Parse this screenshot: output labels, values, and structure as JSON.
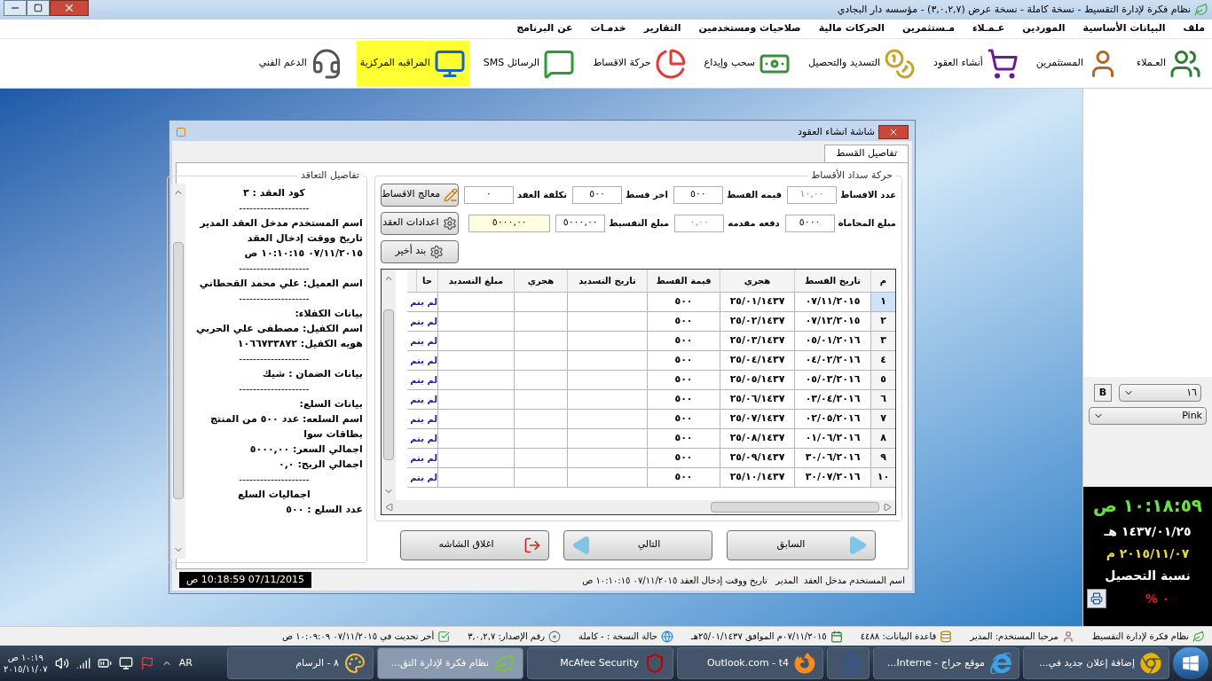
{
  "window": {
    "title": "نظام فكرة لإدارة التقسيط - نسخة كاملة - نسخة عرض (٣,٠,٢,٧) - مؤسسه دار البجادي"
  },
  "menu": [
    "ملف",
    "البيانات الأساسية",
    "الموردين",
    "عـمـلاء",
    "مـستثمرين",
    "الحركات مالية",
    "صلاحيات ومستخدمين",
    "التقارير",
    "خدمـات",
    "عن البرنامج"
  ],
  "toolbar": [
    {
      "label": "العـملاء",
      "kind": "people",
      "highlighted": false
    },
    {
      "label": "المستثمرين",
      "kind": "person",
      "highlighted": false
    },
    {
      "label": "أنشاء العقود",
      "kind": "cart",
      "highlighted": false
    },
    {
      "label": "التسديد والتحصيل",
      "kind": "coins",
      "highlighted": false
    },
    {
      "label": "سحب وإيداع",
      "kind": "cash",
      "highlighted": false
    },
    {
      "label": "حركة الاقساط",
      "kind": "pie",
      "highlighted": false
    },
    {
      "label": "الرسائل SMS",
      "kind": "sms",
      "highlighted": false
    },
    {
      "label": "المراقبه المركزية",
      "kind": "monitor",
      "highlighted": true
    },
    {
      "label": "الدعم الفني",
      "kind": "support",
      "highlighted": false
    }
  ],
  "dialog": {
    "title": "شاشة انشاء العقود",
    "tabs": [
      {
        "label": "تفاصيل القسط",
        "selected": true
      }
    ],
    "contract_details": {
      "title": "تفاصيل التعاقد",
      "lines": [
        {
          "kind": "heading",
          "text": "كود العقد : ٣"
        },
        {
          "kind": "separator",
          "text": "--------------------"
        },
        {
          "kind": "line",
          "text": "اسم المستخدم مدخل العقد المدير"
        },
        {
          "kind": "line",
          "text": "تاريخ ووقت إدخال العقد"
        },
        {
          "kind": "line",
          "text": "٠٧/١١/٢٠١٥ ١٠:١٠:١٥ ص"
        },
        {
          "kind": "separator",
          "text": "--------------------"
        },
        {
          "kind": "line",
          "text": "اسم العميل: علي محمد القحطاني"
        },
        {
          "kind": "separator",
          "text": "--------------------"
        },
        {
          "kind": "line",
          "text": "بيانات الكفلاء:"
        },
        {
          "kind": "line",
          "text": "اسم الكفيل: مصطفى علي الحربي"
        },
        {
          "kind": "line",
          "text": "هويه الكفيل: ١٠٦٦٧٣٣٨٧٢"
        },
        {
          "kind": "separator",
          "text": "--------------------"
        },
        {
          "kind": "line",
          "text": "بيانات الضمان : شيك"
        },
        {
          "kind": "separator",
          "text": "--------------------"
        },
        {
          "kind": "line",
          "text": "بيانات السلع:"
        },
        {
          "kind": "line",
          "text": "اسم السلعه: عدد ٥٠٠ من المنتج"
        },
        {
          "kind": "line",
          "text": "بطاقات سوا"
        },
        {
          "kind": "line",
          "text": "اجمالي السعر: ٥٠٠٠,٠٠"
        },
        {
          "kind": "line",
          "text": "اجمالي الربح: ٠,٠"
        },
        {
          "kind": "separator",
          "text": "--------------------"
        },
        {
          "kind": "heading",
          "text": "اجماليات السلع"
        },
        {
          "kind": "line",
          "text": "عدد السلع : ٥٠٠"
        }
      ]
    },
    "payments": {
      "title": "حركة سداد الأقساط",
      "rows": [
        {
          "fields": [
            {
              "label": "عدد الاقساط",
              "value": "١٠,٠٠",
              "disabled": true,
              "highlighted": false
            },
            {
              "label": "قيمه القسط",
              "value": "٥٠٠",
              "disabled": false,
              "highlighted": false
            },
            {
              "label": "اخر قسط",
              "value": "٥٠٠",
              "disabled": false,
              "highlighted": false
            },
            {
              "label": "تكلفة العقد",
              "value": "٠",
              "disabled": false,
              "highlighted": false
            }
          ],
          "button": {
            "label": "معالج الاقساط",
            "kind": "wizard"
          }
        },
        {
          "fields": [
            {
              "label": "مبلغ المحاماة",
              "value": "٥٠٠٠",
              "disabled": false,
              "highlighted": false
            },
            {
              "label": "دفعه مقدمه",
              "value": "٠,٠٠",
              "disabled": true,
              "highlighted": false
            },
            {
              "label": "مبلغ التقسيط",
              "value": "٥٠٠٠,٠٠",
              "disabled": false,
              "highlighted": false
            },
            {
              "value": "٥٠٠٠,٠٠",
              "disabled": false,
              "highlighted": true
            }
          ],
          "button": {
            "label": "اعدادات العقد",
            "kind": "settings"
          }
        },
        {
          "fields": [],
          "button": {
            "label": "بند أخير",
            "kind": "settings"
          }
        }
      ],
      "table": {
        "columns": [
          "م",
          "تاريخ القسط",
          "هجري",
          "قيمة القسط",
          "تاريخ التسديد",
          "هجري",
          "مبلغ التسديد",
          "حا"
        ],
        "rows": [
          {
            "number": "١",
            "date": "٠٧/١١/٢٠١٥",
            "hijri": "٢٥/٠١/١٤٣٧",
            "amount": "٥٠٠",
            "status": "لم يتم",
            "selected": true
          },
          {
            "number": "٢",
            "date": "٠٧/١٢/٢٠١٥",
            "hijri": "٢٥/٠٢/١٤٣٧",
            "amount": "٥٠٠",
            "status": "لم يتم",
            "selected": false
          },
          {
            "number": "٣",
            "date": "٠٥/٠١/٢٠١٦",
            "hijri": "٢٥/٠٣/١٤٣٧",
            "amount": "٥٠٠",
            "status": "لم يتم",
            "selected": false
          },
          {
            "number": "٤",
            "date": "٠٤/٠٢/٢٠١٦",
            "hijri": "٢٥/٠٤/١٤٣٧",
            "amount": "٥٠٠",
            "status": "لم يتم",
            "selected": false
          },
          {
            "number": "٥",
            "date": "٠٥/٠٣/٢٠١٦",
            "hijri": "٢٥/٠٥/١٤٣٧",
            "amount": "٥٠٠",
            "status": "لم يتم",
            "selected": false
          },
          {
            "number": "٦",
            "date": "٠٣/٠٤/٢٠١٦",
            "hijri": "٢٥/٠٦/١٤٣٧",
            "amount": "٥٠٠",
            "status": "لم يتم",
            "selected": false
          },
          {
            "number": "٧",
            "date": "٠٢/٠٥/٢٠١٦",
            "hijri": "٢٥/٠٧/١٤٣٧",
            "amount": "٥٠٠",
            "status": "لم يتم",
            "selected": false
          },
          {
            "number": "٨",
            "date": "٠١/٠٦/٢٠١٦",
            "hijri": "٢٥/٠٨/١٤٣٧",
            "amount": "٥٠٠",
            "status": "لم يتم",
            "selected": false
          },
          {
            "number": "٩",
            "date": "٣٠/٠٦/٢٠١٦",
            "hijri": "٢٥/٠٩/١٤٣٧",
            "amount": "٥٠٠",
            "status": "لم يتم",
            "selected": false
          },
          {
            "number": "١٠",
            "date": "٣٠/٠٧/٢٠١٦",
            "hijri": "٢٥/١٠/١٤٣٧",
            "amount": "٥٠٠",
            "status": "لم يتم",
            "selected": false
          }
        ]
      },
      "buttons": [
        {
          "label": "السابق",
          "kind": "back"
        },
        {
          "label": "التالي",
          "kind": "next"
        },
        {
          "label": "اغلاق الشاشه",
          "kind": "exit"
        }
      ]
    },
    "status": {
      "text": "اسم المستخدم مدخل العقد  المدير   تاريخ ووقت إدخال العقد ٠٧/١١/٢٠١٥ ١٠:١٠:١٥ ص",
      "clock": "07/11/2015 10:18:59 ص"
    }
  },
  "side_panel": {
    "bold_button": "B",
    "font_size": "١٦",
    "color_name": "Pink",
    "time": "١٠:١٨:٥٩ ص",
    "hijri_date": "١٤٣٧/٠١/٢٥ هـ",
    "date": "٢٠١٥/١١/٠٧ م",
    "collection_label": "نسبة التحصيل",
    "collection_value": "% ٠"
  },
  "status_bar": [
    {
      "text": "نظام فكرة لإدارة التقسيط",
      "kind": "leaf"
    },
    {
      "text": "مرحبا المستخدم: المدير",
      "kind": "user"
    },
    {
      "text": "قاعدة البيانات: ٤٤٨٨",
      "kind": "database"
    },
    {
      "text": "٠٧/١١/٢٠١٥م الموافق ٢٥/٠١/١٤٣٧هـ",
      "kind": "calendar"
    },
    {
      "text": "حالة النسخة : - كاملة",
      "kind": "globe"
    },
    {
      "text": "رقم الإصدار: ٣,٠,٢,٧",
      "kind": "disc"
    },
    {
      "text": "أخر تحديث في ٠٧/١١/٢٠١٥ ١٠:٠٩:٠٩ ص",
      "kind": "check"
    }
  ],
  "taskbar": {
    "items": [
      {
        "label": "إضافة إعلان جديد في...",
        "kind": "chrome",
        "active": false
      },
      {
        "label": "موقع حراج - Interne...",
        "kind": "ie",
        "active": false
      },
      {
        "kind": "word",
        "active": false
      },
      {
        "label": "Outlook.com - t4",
        "kind": "firefox",
        "active": false
      },
      {
        "label": "McAfee Security",
        "kind": "shield",
        "active": false
      },
      {
        "label": "نظام فكرة لإدارة التق...",
        "kind": "leaf",
        "active": true
      },
      {
        "label": "٨ - الرسام",
        "kind": "paint",
        "active": false
      }
    ],
    "language": "AR",
    "time": "١٠:١٩ ص",
    "date": "٢٠١٥/١١/٠٧"
  }
}
